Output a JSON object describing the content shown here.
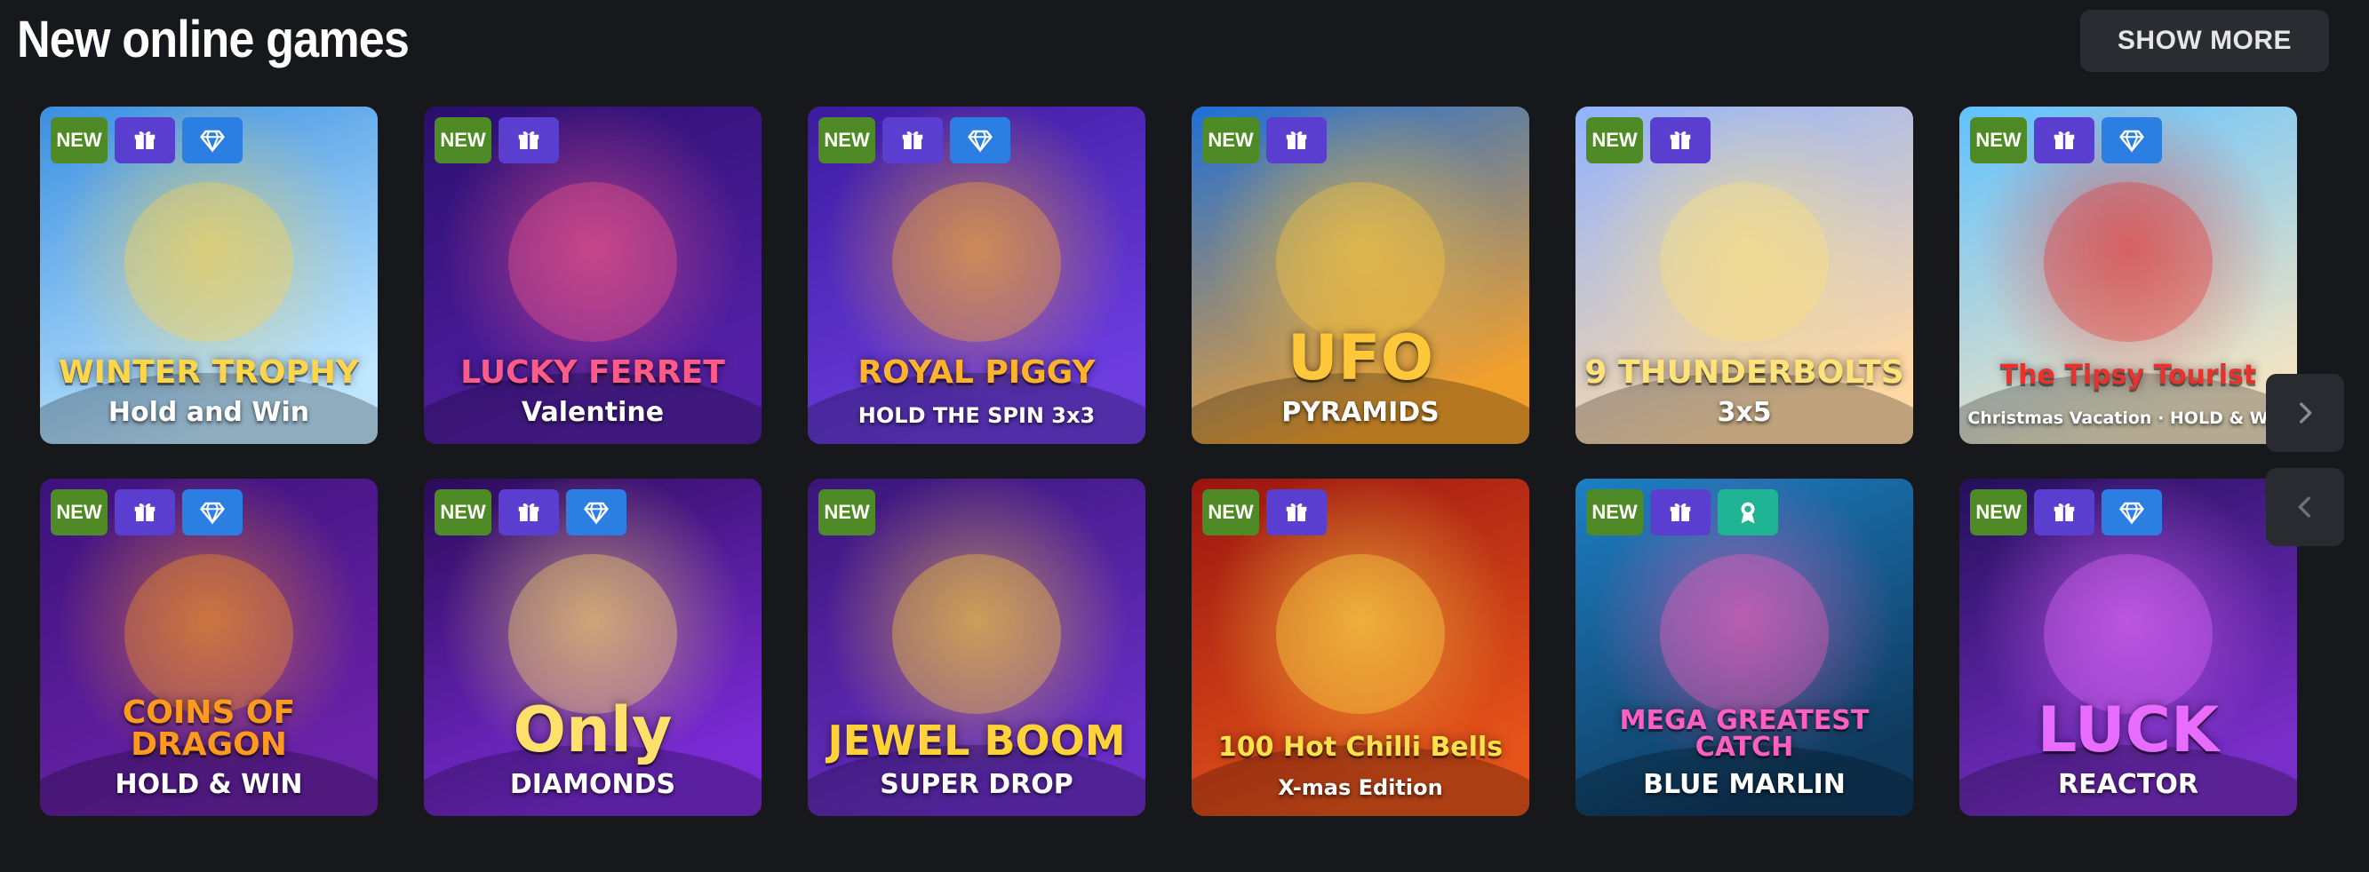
{
  "section": {
    "title": "New online games",
    "show_more_label": "SHOW MORE"
  },
  "badges": {
    "new_label": "NEW"
  },
  "games": [
    {
      "title_line1": "WINTER TROPHY",
      "title_line2": "Hold and Win",
      "badges": [
        "new",
        "gift",
        "diamond"
      ],
      "colors": [
        "#3a8fe0",
        "#bfe6ff"
      ],
      "accent": "#ffd54a"
    },
    {
      "title_line1": "LUCKY FERRET",
      "title_line2": "Valentine",
      "badges": [
        "new",
        "gift"
      ],
      "colors": [
        "#2a0f6e",
        "#5520a8"
      ],
      "accent": "#ff5a88"
    },
    {
      "title_line1": "ROYAL PIGGY",
      "title_line2": "HOLD THE SPIN 3x3",
      "badges": [
        "new",
        "gift",
        "diamond"
      ],
      "colors": [
        "#3b1b9e",
        "#6d3de0"
      ],
      "accent": "#ffb22b"
    },
    {
      "title_line1": "UFO",
      "title_line2": "PYRAMIDS",
      "badges": [
        "new",
        "gift"
      ],
      "colors": [
        "#1d6fd8",
        "#f2a02c"
      ],
      "accent": "#ffc83a"
    },
    {
      "title_line1": "9 THUNDERBOLTS",
      "title_line2": "3x5",
      "badges": [
        "new",
        "gift"
      ],
      "colors": [
        "#8fb2ff",
        "#ffd9a4"
      ],
      "accent": "#ffe37a"
    },
    {
      "title_line1": "The Tipsy Tourist",
      "title_line2": "Christmas Vacation · HOLD & WIN",
      "badges": [
        "new",
        "gift",
        "diamond"
      ],
      "colors": [
        "#5fc1ff",
        "#f0e3c4"
      ],
      "accent": "#e7322e"
    },
    {
      "title_line1": "COINS OF DRAGON",
      "title_line2": "HOLD & WIN",
      "badges": [
        "new",
        "gift",
        "diamond"
      ],
      "colors": [
        "#3c127a",
        "#6a22a9"
      ],
      "accent": "#ff9a1e"
    },
    {
      "title_line1": "Only",
      "title_line2": "DIAMONDS",
      "badges": [
        "new",
        "gift",
        "diamond"
      ],
      "colors": [
        "#2b0b59",
        "#7a2bd6"
      ],
      "accent": "#ffe06a"
    },
    {
      "title_line1": "JEWEL BOOM",
      "title_line2": "SUPER DROP",
      "badges": [
        "new"
      ],
      "colors": [
        "#3a1578",
        "#6a2fc8"
      ],
      "accent": "#ffd23a"
    },
    {
      "title_line1": "100 Hot Chilli Bells",
      "title_line2": "X-mas Edition",
      "badges": [
        "new",
        "gift"
      ],
      "colors": [
        "#9a1410",
        "#e5531a"
      ],
      "accent": "#ffe24a"
    },
    {
      "title_line1": "MEGA GREATEST CATCH",
      "title_line2": "BLUE MARLIN",
      "badges": [
        "new",
        "gift",
        "award"
      ],
      "colors": [
        "#1d7fc4",
        "#0f3a5e"
      ],
      "accent": "#ff5fc0"
    },
    {
      "title_line1": "LUCK",
      "title_line2": "REACTOR",
      "badges": [
        "new",
        "gift",
        "diamond"
      ],
      "colors": [
        "#23105a",
        "#7a2ec9"
      ],
      "accent": "#e86cff"
    }
  ],
  "navigation": {
    "next_icon": "chevron-right-icon",
    "prev_icon": "chevron-left-icon"
  }
}
